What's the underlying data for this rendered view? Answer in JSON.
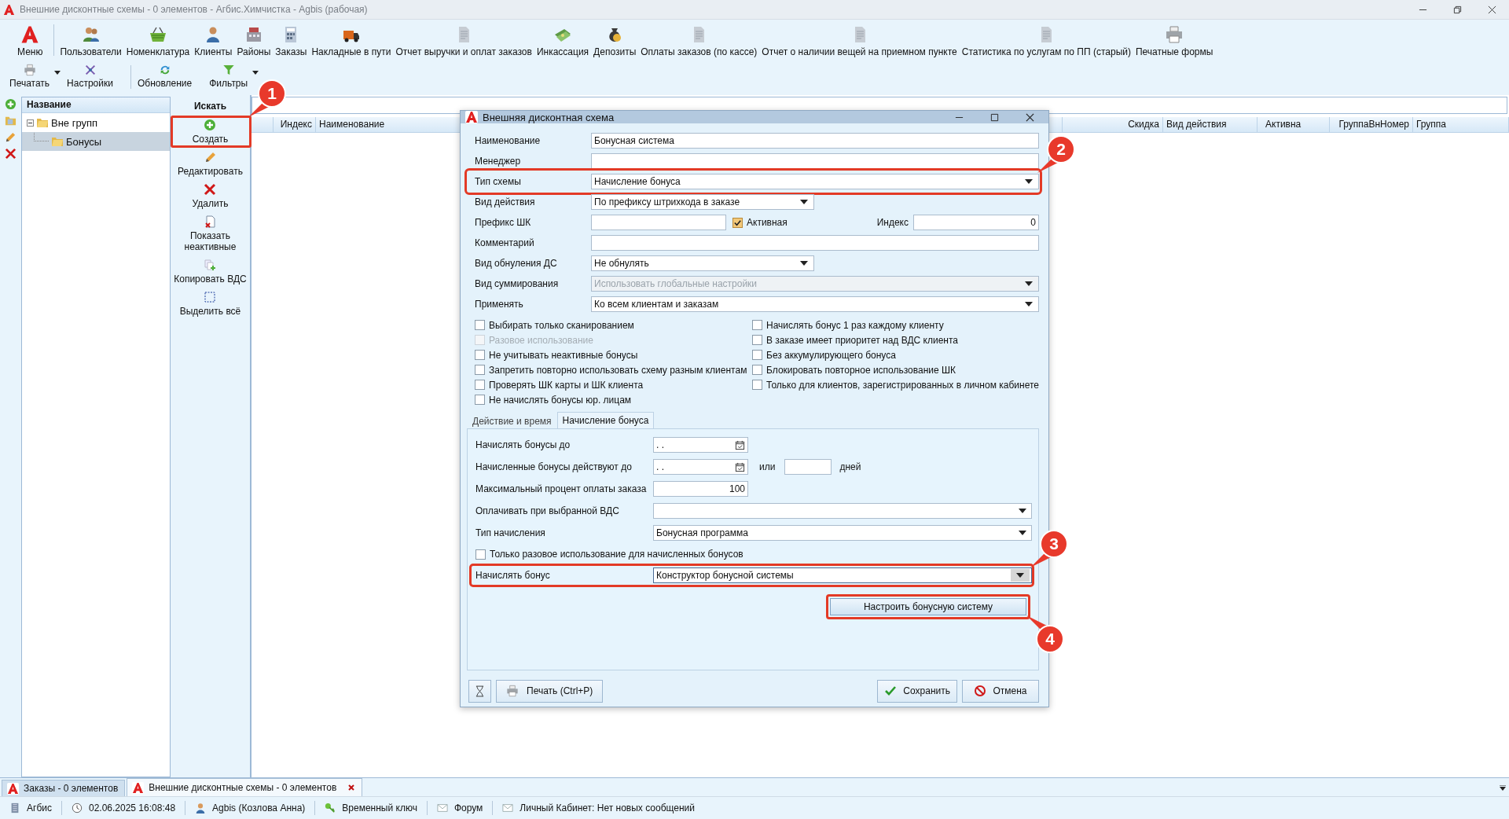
{
  "window": {
    "title": "Внешние дисконтные схемы - 0 элементов - Агбис.Химчистка - Agbis (рабочая)"
  },
  "ribbon": {
    "menu_label": "Меню",
    "items": [
      "Пользователи",
      "Номенклатура",
      "Клиенты",
      "Районы",
      "Заказы",
      "Накладные в пути",
      "Отчет выручки и оплат заказов",
      "Инкассация",
      "Депозиты",
      "Оплаты заказов (по кассе)",
      "Отчет о наличии вещей на приемном пункте",
      "Статистика по услугам по ПП (старый)",
      "Печатные формы"
    ],
    "row2": [
      {
        "label": "Печатать",
        "dropdown": true
      },
      {
        "label": "Настройки",
        "dropdown": false
      },
      {
        "label": "Обновление",
        "dropdown": false
      },
      {
        "label": "Фильтры",
        "dropdown": true
      }
    ]
  },
  "tree": {
    "header": "Название",
    "items": [
      {
        "label": "Вне групп",
        "expanded": true,
        "selected": false,
        "children": [
          {
            "label": "Бонусы",
            "selected": true
          }
        ]
      }
    ]
  },
  "actions": {
    "title": "Искать",
    "items": [
      {
        "label": "Создать",
        "callout": {
          "number": "1"
        }
      },
      {
        "label": "Редактировать"
      },
      {
        "label": "Удалить"
      },
      {
        "label": "Показать неактивные"
      },
      {
        "label": "Копировать ВДС"
      },
      {
        "label": "Выделить всё"
      }
    ]
  },
  "grid": {
    "columns": [
      "Индекс",
      "Наименование",
      "Скидка",
      "Вид действия",
      "Активна",
      "ГруппаВнНомер",
      "Группа"
    ]
  },
  "dialog": {
    "title": "Внешняя дисконтная схема",
    "fields": [
      {
        "kind": "text",
        "label": "Наименование",
        "value": "Бонусная система",
        "disabled": false
      },
      {
        "kind": "text",
        "label": "Менеджер",
        "disabled": false
      },
      {
        "kind": "select",
        "label": "Тип схемы",
        "value": "Начисление бонуса",
        "disabled": false,
        "callout": {
          "number": "2"
        }
      },
      {
        "kind": "select-short",
        "label": "Вид действия",
        "value": "По префиксу штрихкода в заказе",
        "disabled": false
      },
      {
        "kind": "prefix",
        "label": "Префикс ШК",
        "disabled": false,
        "check_label": "Активная",
        "checked": true,
        "index_label": "Индекс",
        "index_value": "0"
      },
      {
        "kind": "text",
        "label": "Комментарий",
        "disabled": false
      },
      {
        "kind": "select-short",
        "label": "Вид обнуления ДС",
        "value": "Не обнулять",
        "disabled": false
      },
      {
        "kind": "select",
        "label": "Вид суммирования",
        "value": "Использовать глобальные настройки",
        "disabled": true
      },
      {
        "kind": "select",
        "label": "Применять",
        "value": "Ко всем клиентам и заказам",
        "disabled": false
      }
    ],
    "options_left": [
      {
        "label": "Выбирать только сканированием",
        "checked": false,
        "disabled": false
      },
      {
        "label": "Разовое использование",
        "checked": false,
        "disabled": true
      },
      {
        "label": "Не учитывать неактивные бонусы",
        "checked": false,
        "disabled": false
      },
      {
        "label": "Запретить повторно использовать схему разным клиентам",
        "checked": false,
        "disabled": false
      },
      {
        "label": "Проверять ШК карты и ШК клиента",
        "checked": false,
        "disabled": false
      },
      {
        "label": "Не начислять бонусы юр. лицам",
        "checked": false,
        "disabled": false
      }
    ],
    "options_right": [
      {
        "label": "Начислять бонус 1 раз каждому клиенту",
        "checked": false,
        "disabled": false
      },
      {
        "label": "В заказе имеет приоритет над ВДС клиента",
        "checked": false,
        "disabled": false
      },
      {
        "label": "Без аккумулирующего бонуса",
        "checked": false,
        "disabled": false
      },
      {
        "label": "Блокировать повторное использование ШК",
        "checked": false,
        "disabled": false
      },
      {
        "label": "Только для клиентов, зарегистрированных в личном кабинете",
        "checked": false,
        "disabled": false
      }
    ],
    "tabs": [
      {
        "label": "Действие и время",
        "selected": false
      },
      {
        "label": "Начисление бонуса",
        "selected": true
      }
    ],
    "tab_fields": [
      {
        "kind": "date",
        "label": "Начислять бонусы до",
        "value": ". ."
      },
      {
        "kind": "date-days",
        "label": "Начисленные бонусы действуют до",
        "value": ". .",
        "or_label": "или",
        "days_label": "дней"
      },
      {
        "kind": "number",
        "label": "Максимальный процент оплаты заказа",
        "value": "100"
      },
      {
        "kind": "select",
        "label": "Оплачивать при выбранной ВДС"
      },
      {
        "kind": "select",
        "label": "Тип начисления",
        "value": "Бонусная программа"
      },
      {
        "kind": "checkbox",
        "label": "Только разовое использование для начисленных бонусов",
        "checked": false
      },
      {
        "kind": "select",
        "label": "Начислять бонус",
        "value": "Конструктор бонусной системы",
        "callout": {
          "number": "3"
        }
      }
    ],
    "configure_button": {
      "label": "Настроить бонусную систему",
      "callout": {
        "number": "4"
      }
    },
    "print_button": "Печать (Ctrl+P)",
    "save_button": "Сохранить",
    "cancel_button": "Отмена"
  },
  "doc_tabs": [
    {
      "label": "Заказы - 0 элементов",
      "selected": false,
      "closable": false
    },
    {
      "label": "Внешние дисконтные схемы - 0 элементов",
      "selected": true,
      "closable": true
    }
  ],
  "status_bar": [
    "Агбис",
    "02.06.2025 16:08:48",
    "Agbis (Козлова Анна)",
    "Временный ключ",
    "Форум",
    "Личный Кабинет: Нет новых сообщений"
  ]
}
